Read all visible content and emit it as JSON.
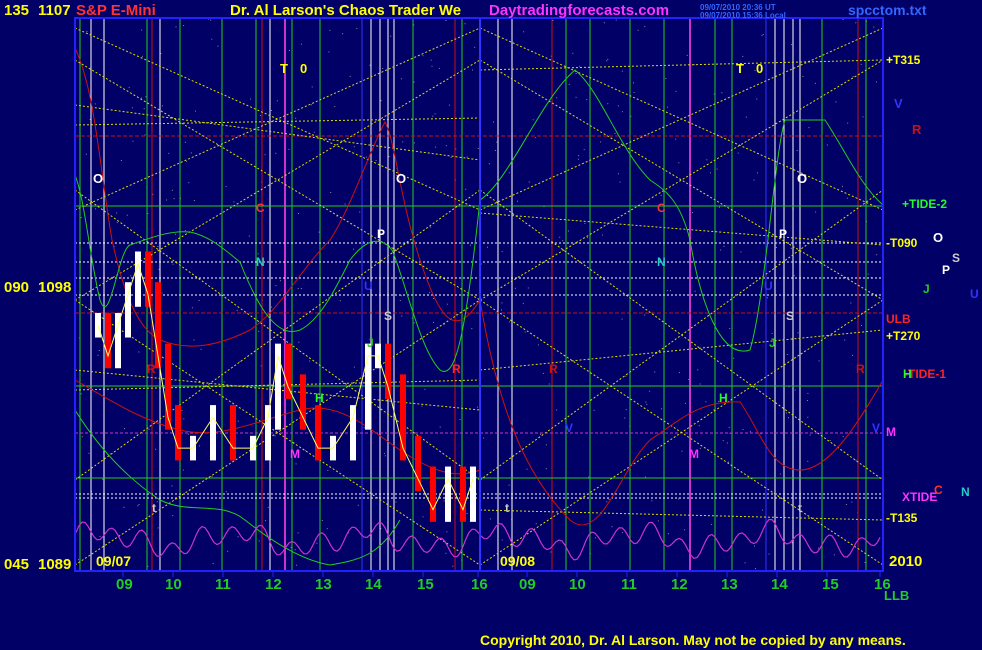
{
  "header": {
    "top_left_num": "135",
    "top_left_price": "1107",
    "instrument": "S&P E-Mini",
    "title_prefix": "Dr. Al Larson's Chaos Trader We",
    "title_site": "Daytradingforecasts.com",
    "stamp_line1": "09/07/2010 20:36 UT",
    "stamp_line2": "09/07/2010 15:36 Local",
    "filename": "spcctom.txt"
  },
  "left_axis": {
    "mid_num": "090",
    "mid_price": "1098",
    "bottom_num": "045",
    "bottom_price": "1089"
  },
  "dates": {
    "panel1": "09/07",
    "panel2": "09/08",
    "year": "2010"
  },
  "x_ticks": [
    "09",
    "10",
    "11",
    "12",
    "13",
    "14",
    "15",
    "16",
    "09",
    "10",
    "11",
    "12",
    "13",
    "14",
    "15",
    "16"
  ],
  "right_labels": {
    "t315": "+T315",
    "tide2": "+TIDE-2",
    "t090": "-T090",
    "ulb": "ULB",
    "t270": "+T270",
    "tide1": "-TIDE-1",
    "xtide": "XTIDE",
    "t135": "-T135",
    "llb": "LLB"
  },
  "planet_labels": {
    "v": "V",
    "r": "R",
    "o": "O",
    "p": "P",
    "s": "S",
    "j": "J",
    "u": "U",
    "h": "H",
    "m": "M",
    "c": "C",
    "n": "N",
    "t": "T",
    "zero": "0",
    "tlow": "t"
  },
  "footer": {
    "copyright": "Copyright 2010, Dr. Al Larson. May not be copied by any means."
  },
  "colors": {
    "background": "#000066",
    "frame": "#2222ff",
    "price_up": "#ffffff",
    "price_down": "#ff0000",
    "tide_green": "#22cc22",
    "harmonic_red": "#cc1111",
    "flux_magenta": "#cc33cc",
    "lattice_yellow": "#dddd00",
    "label_yellow": "#ffff00",
    "site_magenta": "#ff33ff"
  },
  "chart_data": {
    "type": "line",
    "title": "S&P E-Mini",
    "y_axis": {
      "ticks": [
        1089,
        1098,
        1107
      ],
      "angles": [
        45,
        90,
        135
      ],
      "ylim": [
        1089,
        1107
      ]
    },
    "x_axis": {
      "days": [
        "09/07",
        "09/08"
      ],
      "hours": [
        9,
        10,
        11,
        12,
        13,
        14,
        15,
        16
      ]
    },
    "series": [
      {
        "name": "price",
        "x": [
          8.5,
          8.7,
          8.9,
          9.1,
          9.3,
          9.5,
          9.7,
          9.9,
          10.1,
          10.4,
          10.8,
          11.2,
          11.6,
          11.9,
          12.1,
          12.3,
          12.6,
          12.9,
          13.2,
          13.6,
          13.9,
          14.1,
          14.3,
          14.6,
          14.9,
          15.2,
          15.5,
          15.8,
          16.0
        ],
        "values": [
          1097,
          1096,
          1097,
          1098,
          1099,
          1098,
          1096,
          1094,
          1093,
          1093,
          1094,
          1093,
          1093,
          1094,
          1096,
          1095,
          1094,
          1093,
          1093,
          1094,
          1096,
          1096,
          1095,
          1093,
          1092,
          1091,
          1092,
          1091,
          1092
        ]
      }
    ]
  }
}
